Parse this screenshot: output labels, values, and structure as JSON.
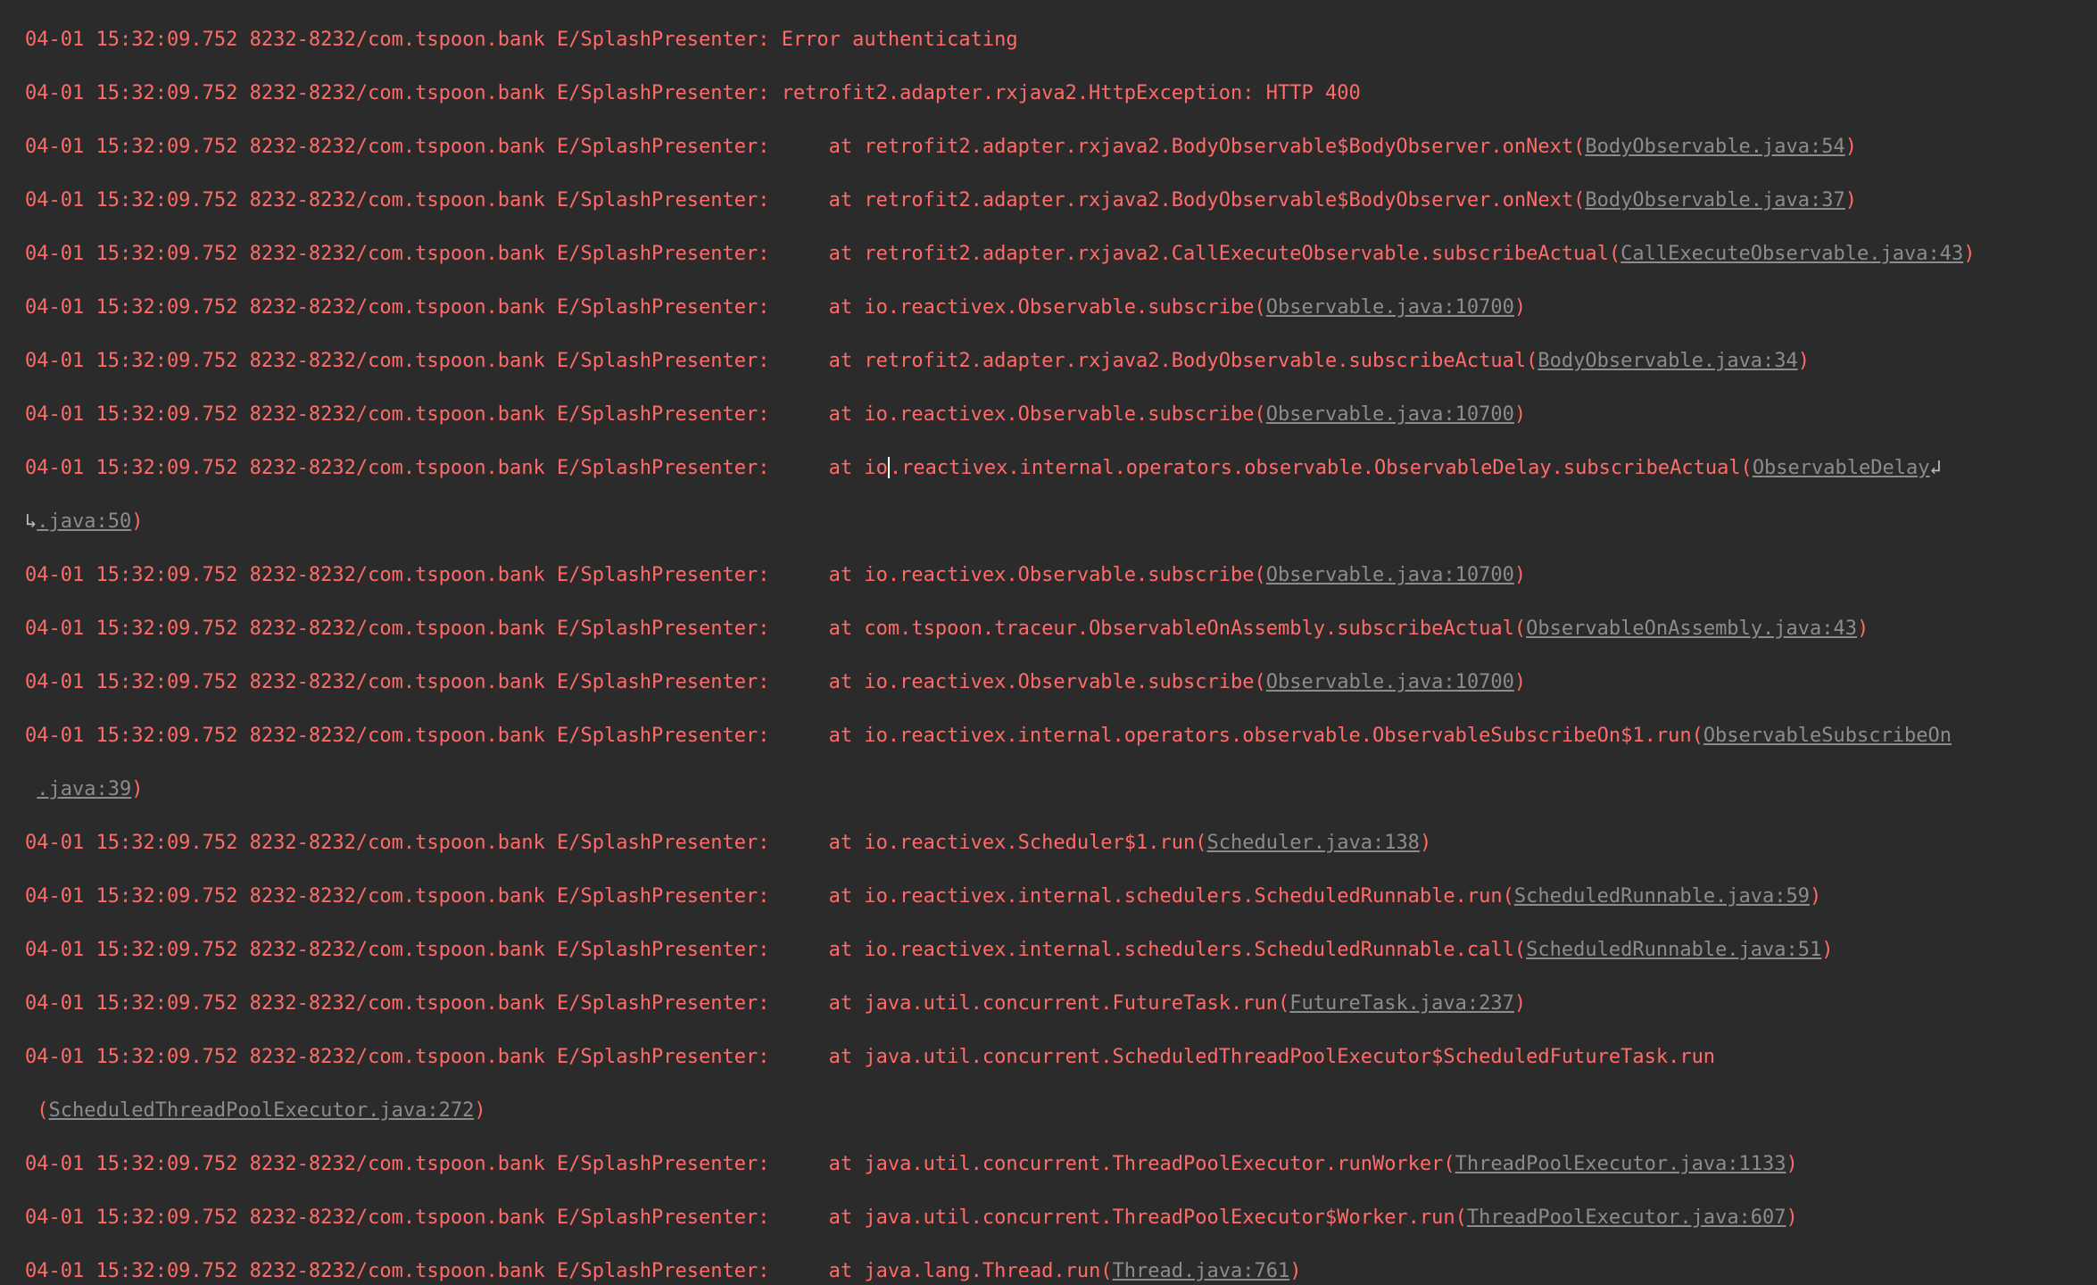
{
  "log": {
    "prefix": "04-01 15:32:09.752 8232-8232/com.tspoon.bank E/SplashPresenter: ",
    "at": "    at ",
    "colors": {
      "background": "#2b2b2b",
      "error_text": "#ff6b68",
      "link": "#8c8c8c"
    },
    "soft_wrap_icon": "↲",
    "soft_wrap_continuation_icon": "↳",
    "lines": [
      {
        "message": "Error authenticating"
      },
      {
        "message": "retrofit2.adapter.rxjava2.HttpException: HTTP 400"
      },
      {
        "method": "retrofit2.adapter.rxjava2.BodyObservable$BodyObserver.onNext(",
        "link": "BodyObservable.java:54",
        "tail": ")"
      },
      {
        "method": "retrofit2.adapter.rxjava2.BodyObservable$BodyObserver.onNext(",
        "link": "BodyObservable.java:37",
        "tail": ")"
      },
      {
        "method": "retrofit2.adapter.rxjava2.CallExecuteObservable.subscribeActual(",
        "link": "CallExecuteObservable.java:43",
        "tail": ")"
      },
      {
        "method": "io.reactivex.Observable.subscribe(",
        "link": "Observable.java:10700",
        "tail": ")"
      },
      {
        "method": "retrofit2.adapter.rxjava2.BodyObservable.subscribeActual(",
        "link": "BodyObservable.java:34",
        "tail": ")"
      },
      {
        "method": "io.reactivex.Observable.subscribe(",
        "link": "Observable.java:10700",
        "tail": ")"
      },
      {
        "method_a": "io",
        "method_b": ".reactivex.internal.operators.observable.ObservableDelay.subscribeActual(",
        "link1": "ObservableDelay",
        "link2": ".java:50",
        "tail": ")"
      },
      {
        "method": "io.reactivex.Observable.subscribe(",
        "link": "Observable.java:10700",
        "tail": ")"
      },
      {
        "method": "com.tspoon.traceur.ObservableOnAssembly.subscribeActual(",
        "link": "ObservableOnAssembly.java:43",
        "tail": ")"
      },
      {
        "method": "io.reactivex.Observable.subscribe(",
        "link": "Observable.java:10700",
        "tail": ")"
      },
      {
        "method": "io.reactivex.internal.operators.observable.ObservableSubscribeOn$1.run(",
        "link1": "ObservableSubscribeOn",
        "link2": ".java:39",
        "tail": ")"
      },
      {
        "method": "io.reactivex.Scheduler$1.run(",
        "link": "Scheduler.java:138",
        "tail": ")"
      },
      {
        "method": "io.reactivex.internal.schedulers.ScheduledRunnable.run(",
        "link": "ScheduledRunnable.java:59",
        "tail": ")"
      },
      {
        "method": "io.reactivex.internal.schedulers.ScheduledRunnable.call(",
        "link": "ScheduledRunnable.java:51",
        "tail": ")"
      },
      {
        "method": "java.util.concurrent.FutureTask.run(",
        "link": "FutureTask.java:237",
        "tail": ")"
      },
      {
        "method": "java.util.concurrent.ScheduledThreadPoolExecutor$ScheduledFutureTask.run",
        "wrap_open": "(",
        "link": "ScheduledThreadPoolExecutor.java:272",
        "tail": ")"
      },
      {
        "method": "java.util.concurrent.ThreadPoolExecutor.runWorker(",
        "link": "ThreadPoolExecutor.java:1133",
        "tail": ")"
      },
      {
        "method": "java.util.concurrent.ThreadPoolExecutor$Worker.run(",
        "link": "ThreadPoolExecutor.java:607",
        "tail": ")"
      },
      {
        "method": "java.lang.Thread.run(",
        "link": "Thread.java:761",
        "tail": ")"
      }
    ]
  }
}
